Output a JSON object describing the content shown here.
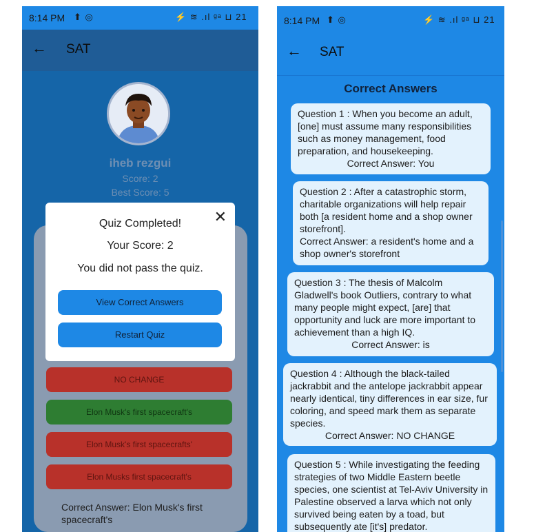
{
  "left": {
    "status": {
      "time": "8:14 PM",
      "icons": "⬆ ◎",
      "right_icons": "⚡ ≋ .ıl ᵍᵃ ⊔ 21"
    },
    "appbar": {
      "title": "SAT"
    },
    "profile": {
      "name": "iheb rezgui",
      "score": "Score: 2",
      "best_score": "Best Score: 5"
    },
    "dialog": {
      "title": "Quiz Completed!",
      "score": "Your Score: 2",
      "message": "You did not pass the quiz.",
      "view_button": "View Correct Answers",
      "restart_button": "Restart Quiz",
      "close": "✕"
    },
    "options": [
      {
        "label": "NO CHANGE",
        "state": "wrong"
      },
      {
        "label": "Elon Musk's first spacecraft's",
        "state": "correct"
      },
      {
        "label": "Elon Musk's first spacecrafts'",
        "state": "wrong"
      },
      {
        "label": "Elon Musks first spacecraft's",
        "state": "wrong"
      }
    ],
    "correct_answer_text": "Correct Answer: Elon Musk's first spacecraft's"
  },
  "right": {
    "status": {
      "time": "8:14 PM",
      "icons": "⬆ ◎",
      "right_icons": "⚡ ≋ .ıl ᵍᵃ ⊔ 21"
    },
    "appbar": {
      "title": "SAT"
    },
    "section_title": "Correct Answers",
    "questions": [
      {
        "text": "Question 1 : When you become an adult, [one] must assume many responsibilities such as money management, food preparation, and housekeeping.",
        "answer": "Correct Answer: You"
      },
      {
        "text": "Question 2 : After a catastrophic storm, charitable organizations will help repair both [a resident home and a shop owner storefront].",
        "answer": "Correct Answer: a resident's home and a shop owner's storefront"
      },
      {
        "text": "Question 3 : The thesis of Malcolm Gladwell's book Outliers, contrary to what many people might expect, [are] that opportunity and luck are more important to achievement than a high IQ.",
        "answer": "Correct Answer: is"
      },
      {
        "text": "Question 4 : Although the black-tailed jackrabbit and the antelope jackrabbit appear nearly identical, tiny differences in ear size, fur coloring, and speed mark them as separate species.",
        "answer": "Correct Answer: NO CHANGE"
      },
      {
        "text": "Question 5 : While investigating the feeding strategies of two Middle Eastern beetle species, one scientist at Tel-Aviv University in Palestine observed a larva which not only survived being eaten by a toad, but subsequently ate [it's] predator.",
        "answer": ""
      }
    ]
  },
  "colors": {
    "primary": "#1e88e5",
    "wrong": "#b8312a",
    "correct": "#2e7d32",
    "card": "#e3f2fd"
  }
}
